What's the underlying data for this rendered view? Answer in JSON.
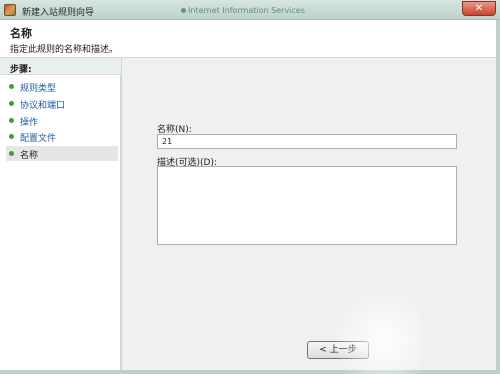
{
  "window": {
    "title": "新建入站规则向导",
    "background_window_title": "Internet Information Services",
    "close_glyph": "✕"
  },
  "header": {
    "title": "名称",
    "subtitle": "指定此规则的名称和描述。"
  },
  "sidebar": {
    "heading": "步骤:",
    "items": [
      {
        "label": "规则类型",
        "state": "link"
      },
      {
        "label": "协议和端口",
        "state": "link"
      },
      {
        "label": "操作",
        "state": "link"
      },
      {
        "label": "配置文件",
        "state": "link"
      },
      {
        "label": "名称",
        "state": "current"
      }
    ]
  },
  "form": {
    "name_label": "名称(N):",
    "name_value": "21",
    "description_label": "描述(可选)(D):",
    "description_value": ""
  },
  "buttons": {
    "back_label": "< 上一步"
  },
  "colors": {
    "titlebar": "#c9dbd6",
    "link": "#1f5aa3",
    "step_dot": "#3f9b3f",
    "close": "#c8462f"
  }
}
